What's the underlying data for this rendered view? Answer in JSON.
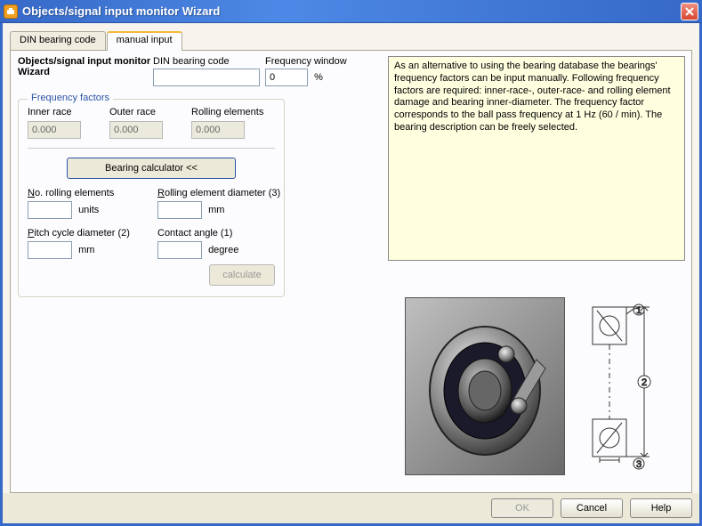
{
  "titlebar": {
    "title": "Objects/signal input monitor Wizard"
  },
  "tabs": {
    "din_tab": "DIN bearing code",
    "manual_tab": "manual input"
  },
  "header": {
    "wizard_title": "Objects/signal input monitor Wizard",
    "din_label": "DIN bearing code",
    "din_value": "",
    "freq_window_label": "Frequency window",
    "freq_window_value": "0",
    "percent": "%"
  },
  "factors": {
    "group_title": "Frequency factors",
    "inner_label": "Inner race",
    "inner_value": "0.000",
    "outer_label": "Outer race",
    "outer_value": "0.000",
    "rolling_label": "Rolling elements",
    "rolling_value": "0.000"
  },
  "calc": {
    "button": "Bearing calculator <<",
    "no_rolling_label_prefix": "N",
    "no_rolling_label_rest": "o. rolling elements",
    "no_rolling_value": "",
    "no_rolling_unit": "units",
    "roll_diam_label_prefix": "R",
    "roll_diam_label_rest": "olling element diameter (3)",
    "roll_diam_value": "",
    "roll_diam_unit": "mm",
    "pitch_label_prefix": "P",
    "pitch_label_rest": "itch cycle diameter (2)",
    "pitch_value": "",
    "pitch_unit": "mm",
    "contact_label": "Contact angle (1)",
    "contact_value": "",
    "contact_unit": "degree",
    "calculate_button": "calculate"
  },
  "help_text": "As an alternative to using the bearing database the bearings' frequency factors can be input manually. Following frequency factors are required: inner-race-, outer-race- and rolling element damage and bearing inner-diameter. The frequency factor corresponds to the ball pass frequency at 1 Hz (60 / min). The bearing description can be freely selected.",
  "diagram": {
    "mark1": "1",
    "mark2": "2",
    "mark3": "3"
  },
  "buttons": {
    "ok": "OK",
    "cancel": "Cancel",
    "help": "Help"
  }
}
